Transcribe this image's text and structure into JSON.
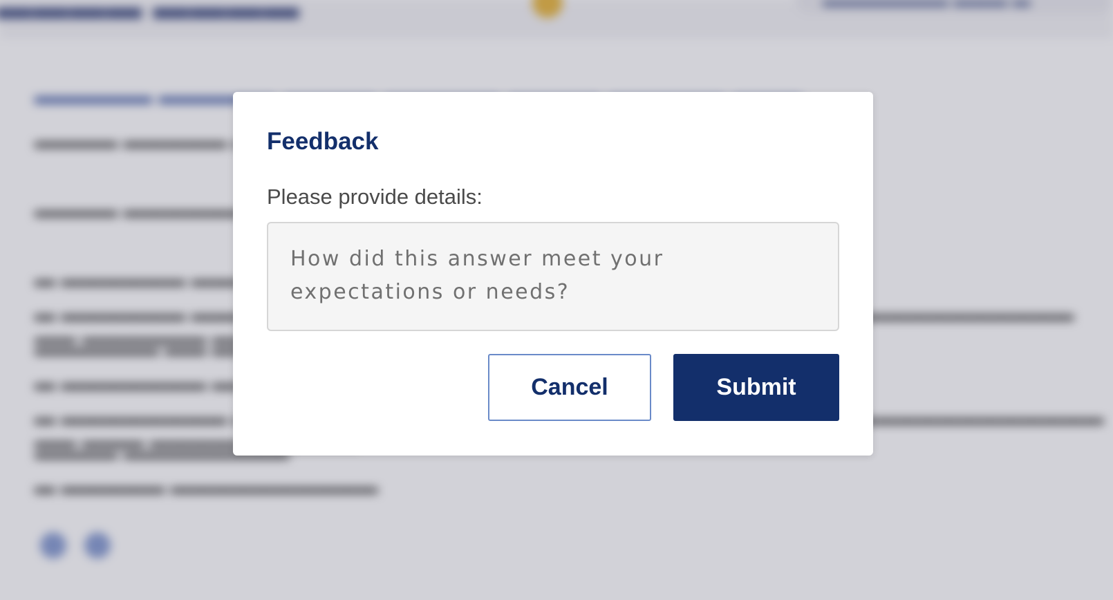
{
  "modal": {
    "title": "Feedback",
    "label": "Please provide details:",
    "textarea": {
      "placeholder": "How did this answer meet your expectations or needs?",
      "value": ""
    },
    "cancel_label": "Cancel",
    "submit_label": "Submit"
  },
  "colors": {
    "primary": "#132f6b",
    "cancel_border": "#6a8ac8",
    "overlay": "#9a9aa8",
    "textarea_bg": "#f5f5f5"
  }
}
